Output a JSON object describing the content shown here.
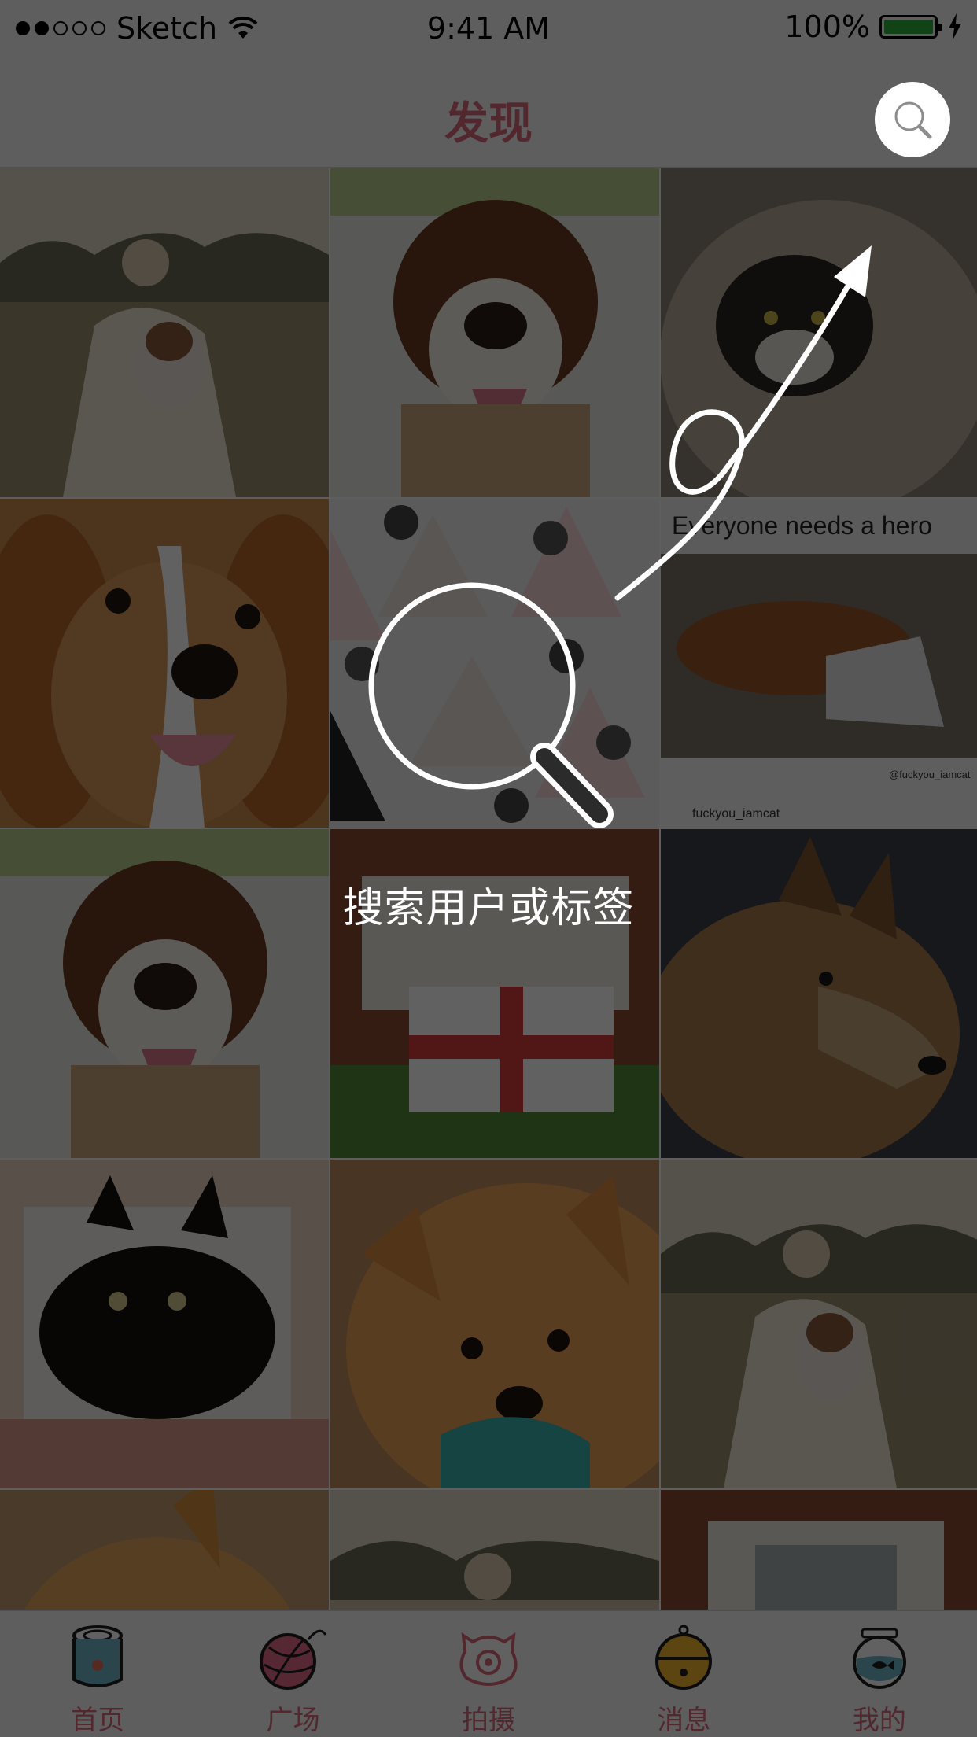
{
  "status_bar": {
    "carrier": "Sketch",
    "time": "9:41 AM",
    "battery": "100%"
  },
  "nav": {
    "title": "发现",
    "search_icon": "search-icon"
  },
  "grid": {
    "items": [
      {
        "subject": "vintage woman with dog"
      },
      {
        "subject": "saint bernard"
      },
      {
        "subject": "cat in basket"
      },
      {
        "subject": "cavalier spaniel"
      },
      {
        "subject": "bulldog stickers"
      },
      {
        "subject": "dog with cone",
        "caption": "Everyone needs a hero",
        "credit": "fuckyou_iamcat",
        "credit2": "@fuckyou_iamcat"
      },
      {
        "subject": "saint bernard"
      },
      {
        "subject": "england flag"
      },
      {
        "subject": "shepherd dog"
      },
      {
        "subject": "black cat"
      },
      {
        "subject": "pomeranian"
      },
      {
        "subject": "vintage woman with dog"
      },
      {
        "subject": "orange cat"
      },
      {
        "subject": "vintage woman with dog"
      },
      {
        "subject": "building window"
      }
    ]
  },
  "guide": {
    "text": "搜索用户或标签"
  },
  "tabbar": {
    "tabs": [
      {
        "label": "首页",
        "icon": "cat-food-can-icon"
      },
      {
        "label": "广场",
        "icon": "yarn-ball-icon"
      },
      {
        "label": "拍摄",
        "icon": "pig-camera-icon"
      },
      {
        "label": "消息",
        "icon": "bell-icon"
      },
      {
        "label": "我的",
        "icon": "fishbowl-icon"
      }
    ]
  },
  "colors": {
    "accent": "#d9667a",
    "overlay": "rgba(0,0,0,0.62)",
    "battery": "#2ab23e"
  }
}
